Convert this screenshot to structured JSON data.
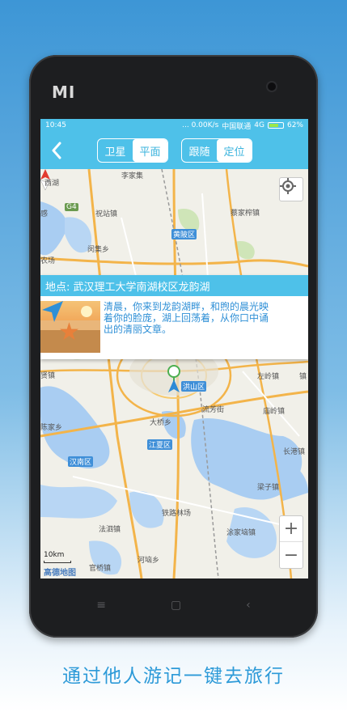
{
  "device": {
    "brand_logo": "MI"
  },
  "statusbar": {
    "time": "10:45",
    "speed": "... 0.00K/s",
    "carrier": "中国联通",
    "network": "4G",
    "battery": "62%"
  },
  "appbar": {
    "back_icon": "chevron-left-icon",
    "map_type": {
      "options": [
        "卫星",
        "平面"
      ],
      "selected": "平面"
    },
    "mode": {
      "options": [
        "跟随",
        "定位"
      ],
      "selected": "定位"
    }
  },
  "map": {
    "labels": [
      "李家集",
      "祝站镇",
      "蔡家榨镇",
      "闵集乡",
      "感",
      "农场",
      "西湖",
      "贤镇",
      "陈家乡",
      "汉南区",
      "洪山区",
      "左岭镇",
      "流芳街",
      "庙岭镇",
      "大桥乡",
      "长港镇",
      "梁子镇",
      "法泗镇",
      "铁路林场",
      "涂家垴镇",
      "河垴乡",
      "官桥镇",
      "镇"
    ],
    "districts": [
      "黄陂区",
      "洪山区",
      "江夏区",
      "汉南区"
    ],
    "highway": "G4",
    "scale": "10km",
    "provider": "高德地图"
  },
  "info_card": {
    "title": "地点: 武汉理工大学南湖校区龙韵湖",
    "description": "清晨，你来到龙韵湖畔，和煦的晨光映着你的脸庞，湖上回荡着，从你口中诵出的清丽文章。",
    "thumbnail": "starfish-beach-image",
    "nav_icon": "navigation-arrow-icon"
  },
  "controls": {
    "locate_icon": "crosshair-icon",
    "zoom_in": "+",
    "zoom_out": "−"
  },
  "caption": "通过他人游记一键去旅行",
  "colors": {
    "accent": "#4ec1e9",
    "caption": "#2d9ad8",
    "description": "#2e8fd6"
  }
}
